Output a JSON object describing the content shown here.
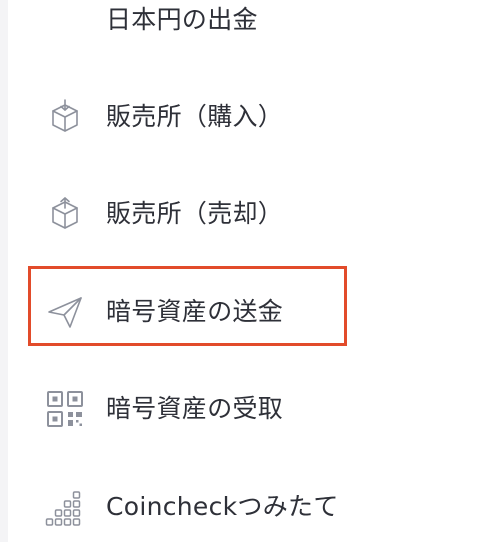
{
  "menu": {
    "items": [
      {
        "label": "日本円の出金",
        "icon": "yen-withdraw-icon"
      },
      {
        "label": "販売所（購入）",
        "icon": "box-buy-icon"
      },
      {
        "label": "販売所（売却）",
        "icon": "box-sell-icon"
      },
      {
        "label": "暗号資産の送金",
        "icon": "paper-plane-icon"
      },
      {
        "label": "暗号資産の受取",
        "icon": "qr-code-icon"
      },
      {
        "label": "Coincheckつみたて",
        "icon": "stacked-squares-icon"
      }
    ]
  },
  "colors": {
    "text": "#2e3038",
    "icon": "#8d919c",
    "highlight": "#e24b2a",
    "background": "#ffffff",
    "page_background": "#f4f4f6"
  }
}
